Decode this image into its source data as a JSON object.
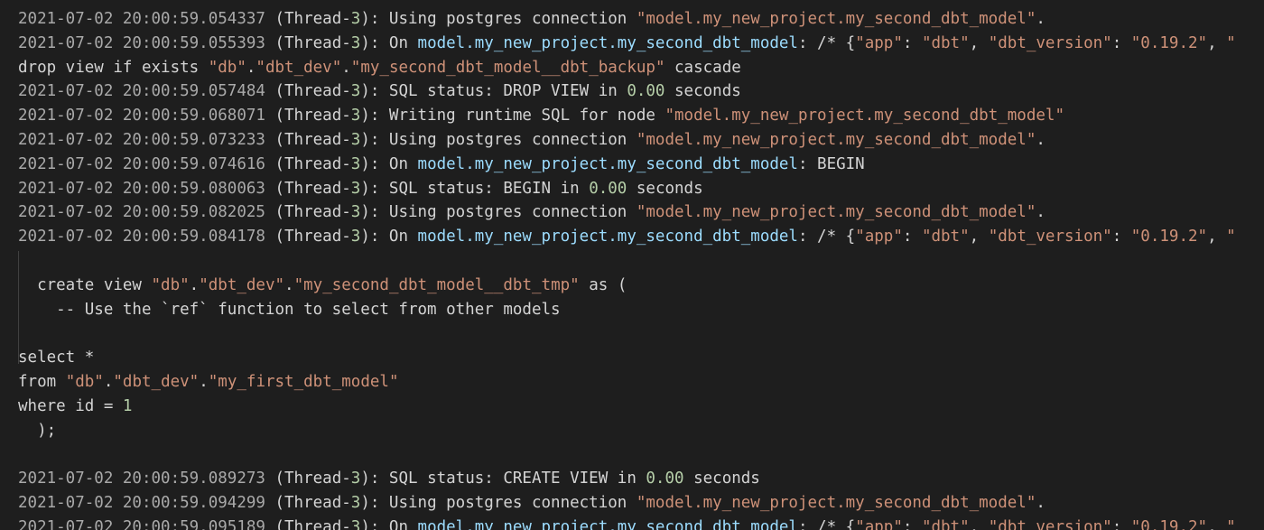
{
  "colors": {
    "background": "#1e1e1e",
    "text": "#d4d4d4",
    "timestamp": "#a9a9a9",
    "number": "#b5cea8",
    "string": "#ce9178",
    "identifier": "#9cdcfe"
  },
  "log_lines": [
    [
      {
        "t": "2021-07-02 20:00:59.054337",
        "c": "ts"
      },
      {
        "t": " (Thread-",
        "c": "txt"
      },
      {
        "t": "3",
        "c": "num"
      },
      {
        "t": "): Using postgres connection ",
        "c": "txt"
      },
      {
        "t": "\"model.my_new_project.my_second_dbt_model\"",
        "c": "str"
      },
      {
        "t": ".",
        "c": "txt"
      }
    ],
    [
      {
        "t": "2021-07-02 20:00:59.055393",
        "c": "ts"
      },
      {
        "t": " (Thread-",
        "c": "txt"
      },
      {
        "t": "3",
        "c": "num"
      },
      {
        "t": "): On ",
        "c": "txt"
      },
      {
        "t": "model.my_new_project.my_second_dbt_model",
        "c": "id"
      },
      {
        "t": ": /* {",
        "c": "txt"
      },
      {
        "t": "\"app\"",
        "c": "str"
      },
      {
        "t": ": ",
        "c": "txt"
      },
      {
        "t": "\"dbt\"",
        "c": "str"
      },
      {
        "t": ", ",
        "c": "txt"
      },
      {
        "t": "\"dbt_version\"",
        "c": "str"
      },
      {
        "t": ": ",
        "c": "txt"
      },
      {
        "t": "\"0.19.2\"",
        "c": "str"
      },
      {
        "t": ", ",
        "c": "txt"
      },
      {
        "t": "\"",
        "c": "str"
      }
    ],
    [
      {
        "t": "drop view if exists ",
        "c": "txt"
      },
      {
        "t": "\"db\"",
        "c": "str"
      },
      {
        "t": ".",
        "c": "txt"
      },
      {
        "t": "\"dbt_dev\"",
        "c": "str"
      },
      {
        "t": ".",
        "c": "txt"
      },
      {
        "t": "\"my_second_dbt_model__dbt_backup\"",
        "c": "str"
      },
      {
        "t": " cascade",
        "c": "txt"
      }
    ],
    [
      {
        "t": "2021-07-02 20:00:59.057484",
        "c": "ts"
      },
      {
        "t": " (Thread-",
        "c": "txt"
      },
      {
        "t": "3",
        "c": "num"
      },
      {
        "t": "): SQL status: DROP VIEW in ",
        "c": "txt"
      },
      {
        "t": "0.00",
        "c": "num"
      },
      {
        "t": " seconds",
        "c": "txt"
      }
    ],
    [
      {
        "t": "2021-07-02 20:00:59.068071",
        "c": "ts"
      },
      {
        "t": " (Thread-",
        "c": "txt"
      },
      {
        "t": "3",
        "c": "num"
      },
      {
        "t": "): Writing runtime SQL for node ",
        "c": "txt"
      },
      {
        "t": "\"model.my_new_project.my_second_dbt_model\"",
        "c": "str"
      }
    ],
    [
      {
        "t": "2021-07-02 20:00:59.073233",
        "c": "ts"
      },
      {
        "t": " (Thread-",
        "c": "txt"
      },
      {
        "t": "3",
        "c": "num"
      },
      {
        "t": "): Using postgres connection ",
        "c": "txt"
      },
      {
        "t": "\"model.my_new_project.my_second_dbt_model\"",
        "c": "str"
      },
      {
        "t": ".",
        "c": "txt"
      }
    ],
    [
      {
        "t": "2021-07-02 20:00:59.074616",
        "c": "ts"
      },
      {
        "t": " (Thread-",
        "c": "txt"
      },
      {
        "t": "3",
        "c": "num"
      },
      {
        "t": "): On ",
        "c": "txt"
      },
      {
        "t": "model.my_new_project.my_second_dbt_model",
        "c": "id"
      },
      {
        "t": ": BEGIN",
        "c": "txt"
      }
    ],
    [
      {
        "t": "2021-07-02 20:00:59.080063",
        "c": "ts"
      },
      {
        "t": " (Thread-",
        "c": "txt"
      },
      {
        "t": "3",
        "c": "num"
      },
      {
        "t": "): SQL status: BEGIN in ",
        "c": "txt"
      },
      {
        "t": "0.00",
        "c": "num"
      },
      {
        "t": " seconds",
        "c": "txt"
      }
    ],
    [
      {
        "t": "2021-07-02 20:00:59.082025",
        "c": "ts"
      },
      {
        "t": " (Thread-",
        "c": "txt"
      },
      {
        "t": "3",
        "c": "num"
      },
      {
        "t": "): Using postgres connection ",
        "c": "txt"
      },
      {
        "t": "\"model.my_new_project.my_second_dbt_model\"",
        "c": "str"
      },
      {
        "t": ".",
        "c": "txt"
      }
    ],
    [
      {
        "t": "2021-07-02 20:00:59.084178",
        "c": "ts"
      },
      {
        "t": " (Thread-",
        "c": "txt"
      },
      {
        "t": "3",
        "c": "num"
      },
      {
        "t": "): On ",
        "c": "txt"
      },
      {
        "t": "model.my_new_project.my_second_dbt_model",
        "c": "id"
      },
      {
        "t": ": /* {",
        "c": "txt"
      },
      {
        "t": "\"app\"",
        "c": "str"
      },
      {
        "t": ": ",
        "c": "txt"
      },
      {
        "t": "\"dbt\"",
        "c": "str"
      },
      {
        "t": ", ",
        "c": "txt"
      },
      {
        "t": "\"dbt_version\"",
        "c": "str"
      },
      {
        "t": ": ",
        "c": "txt"
      },
      {
        "t": "\"0.19.2\"",
        "c": "str"
      },
      {
        "t": ", ",
        "c": "txt"
      },
      {
        "t": "\"",
        "c": "str"
      }
    ],
    [],
    [
      {
        "t": "  create view ",
        "c": "txt"
      },
      {
        "t": "\"db\"",
        "c": "str"
      },
      {
        "t": ".",
        "c": "txt"
      },
      {
        "t": "\"dbt_dev\"",
        "c": "str"
      },
      {
        "t": ".",
        "c": "txt"
      },
      {
        "t": "\"my_second_dbt_model__dbt_tmp\"",
        "c": "str"
      },
      {
        "t": " as (",
        "c": "txt"
      }
    ],
    [
      {
        "t": "    -- Use the `ref` function to select from other models",
        "c": "txt"
      }
    ],
    [],
    [
      {
        "t": "select *",
        "c": "txt"
      }
    ],
    [
      {
        "t": "from ",
        "c": "txt"
      },
      {
        "t": "\"db\"",
        "c": "str"
      },
      {
        "t": ".",
        "c": "txt"
      },
      {
        "t": "\"dbt_dev\"",
        "c": "str"
      },
      {
        "t": ".",
        "c": "txt"
      },
      {
        "t": "\"my_first_dbt_model\"",
        "c": "str"
      }
    ],
    [
      {
        "t": "where id = ",
        "c": "txt"
      },
      {
        "t": "1",
        "c": "num"
      }
    ],
    [
      {
        "t": "  );",
        "c": "txt"
      }
    ],
    [],
    [
      {
        "t": "2021-07-02 20:00:59.089273",
        "c": "ts"
      },
      {
        "t": " (Thread-",
        "c": "txt"
      },
      {
        "t": "3",
        "c": "num"
      },
      {
        "t": "): SQL status: CREATE VIEW in ",
        "c": "txt"
      },
      {
        "t": "0.00",
        "c": "num"
      },
      {
        "t": " seconds",
        "c": "txt"
      }
    ],
    [
      {
        "t": "2021-07-02 20:00:59.094299",
        "c": "ts"
      },
      {
        "t": " (Thread-",
        "c": "txt"
      },
      {
        "t": "3",
        "c": "num"
      },
      {
        "t": "): Using postgres connection ",
        "c": "txt"
      },
      {
        "t": "\"model.my_new_project.my_second_dbt_model\"",
        "c": "str"
      },
      {
        "t": ".",
        "c": "txt"
      }
    ],
    [
      {
        "t": "2021-07-02 20:00:59.095189",
        "c": "ts"
      },
      {
        "t": " (Thread-",
        "c": "txt"
      },
      {
        "t": "3",
        "c": "num"
      },
      {
        "t": "): On ",
        "c": "txt"
      },
      {
        "t": "model.my_new_project.my_second_dbt_model",
        "c": "id"
      },
      {
        "t": ": /* {",
        "c": "txt"
      },
      {
        "t": "\"app\"",
        "c": "str"
      },
      {
        "t": ": ",
        "c": "txt"
      },
      {
        "t": "\"dbt\"",
        "c": "str"
      },
      {
        "t": ", ",
        "c": "txt"
      },
      {
        "t": "\"dbt_version\"",
        "c": "str"
      },
      {
        "t": ": ",
        "c": "txt"
      },
      {
        "t": "\"0.19.2\"",
        "c": "str"
      },
      {
        "t": ", ",
        "c": "txt"
      },
      {
        "t": "\"",
        "c": "str"
      }
    ]
  ]
}
